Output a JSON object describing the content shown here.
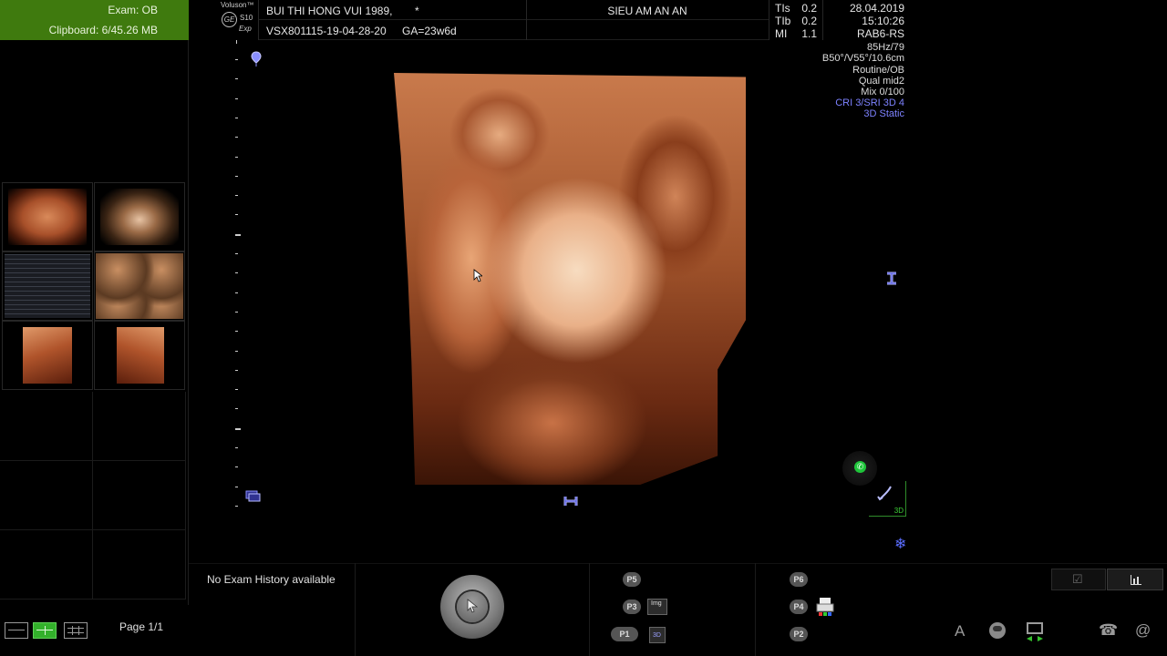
{
  "exam": {
    "exam_label": "Exam: OB",
    "clipboard_label": "Clipboard: 6/45.26 MB"
  },
  "brand": {
    "voluson": "Voluson™",
    "model": "S10",
    "exp": "Exp",
    "logo_text": "GE"
  },
  "patient": {
    "name": "BUI THI HONG VUI 1989,",
    "asterisk": "*",
    "exam_id": "VSX801115-19-04-28-20",
    "ga": "GA=23w6d"
  },
  "institution": "SIEU AM AN AN",
  "indices": [
    {
      "label": "TIs",
      "value": "0.2"
    },
    {
      "label": "TIb",
      "value": "0.2"
    },
    {
      "label": "MI",
      "value": "1.1"
    }
  ],
  "datetime": {
    "date": "28.04.2019",
    "time": "15:10:26"
  },
  "probe": "RAB6-RS",
  "params": [
    {
      "text": "85Hz/79",
      "blue": false
    },
    {
      "text": "B50°/V55°/10.6cm",
      "blue": false
    },
    {
      "text": "Routine/OB",
      "blue": false
    },
    {
      "text": "Qual mid2",
      "blue": false
    },
    {
      "text": "Mix 0/100",
      "blue": false
    },
    {
      "text": "CRI 3/SRI 3D 4",
      "blue": true
    },
    {
      "text": "3D Static",
      "blue": true
    }
  ],
  "render_mode_label": "3D",
  "bottom": {
    "history": "No Exam History available",
    "page": "Page 1/1",
    "p_buttons": {
      "p5": "P5",
      "p3": "P3",
      "p1": "P1",
      "p6": "P6",
      "p4": "P4",
      "p2": "P2"
    },
    "img_label": "Img",
    "threed_label": "3D",
    "font_button": "A"
  },
  "colors": {
    "exam_header_bg": "#3f7a0e",
    "accent_green": "#33b12b",
    "accent_blue": "#7d82ff"
  },
  "icons": [
    "focus-marker-icon",
    "cursor-icon",
    "orientation-icon",
    "trackball-icon",
    "gear-icon",
    "printer-icon",
    "telephone-icon",
    "at-sign-icon"
  ]
}
